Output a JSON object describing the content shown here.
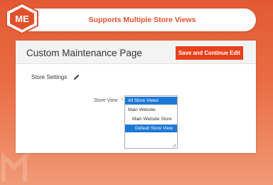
{
  "banner": {
    "title": "Supports Multiple Store Views"
  },
  "logo": {
    "text": "ME"
  },
  "header": {
    "page_title": "Custom Maintenance Page",
    "save_button_label": "Save and Continue Edit"
  },
  "section": {
    "title": "Store Settings",
    "icon": "pencil-icon"
  },
  "store_view_field": {
    "label": "Store View",
    "required_mark": "*",
    "options": [
      {
        "label": "All Store Views",
        "selected": true
      },
      {
        "label": "Main Website",
        "selected": false
      },
      {
        "label": "Main Website Store",
        "selected": false
      },
      {
        "label": "Default Store View",
        "selected": true
      }
    ]
  },
  "colors": {
    "accent": "#e8411b",
    "banner_text": "#e0502b",
    "selection": "#1e78d6",
    "background_top": "#e25a33",
    "background_bottom": "#f09a76"
  }
}
